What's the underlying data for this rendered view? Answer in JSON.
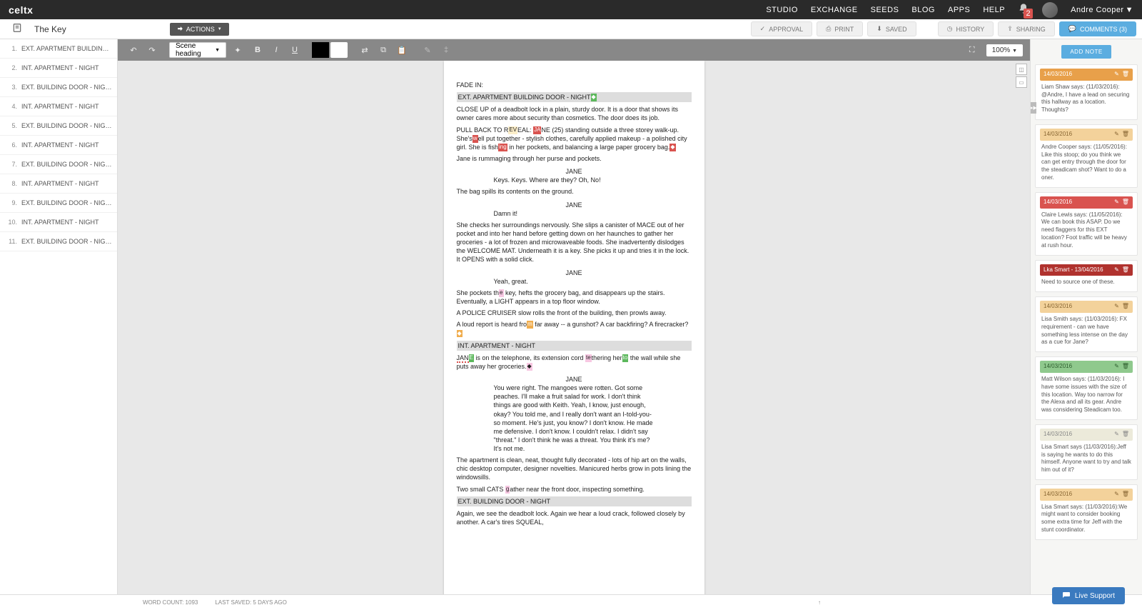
{
  "brand": "celtx",
  "nav": {
    "studio": "STUDIO",
    "exchange": "EXCHANGE",
    "seeds": "SEEDS",
    "blog": "BLOG",
    "apps": "APPS",
    "help": "HELP"
  },
  "user": "Andre Cooper",
  "notif_count": "2",
  "project_title": "The Key",
  "actions_label": "ACTIONS",
  "pills": {
    "approval": "APPROVAL",
    "print": "PRINT",
    "saved": "SAVED",
    "history": "HISTORY",
    "sharing": "SHARING",
    "comments": "COMMENTS (3)"
  },
  "format_dropdown": "Scene heading",
  "zoom": "100%",
  "scenes": [
    {
      "n": "1.",
      "t": "EXT. APARTMENT BUILDING DOOR ..."
    },
    {
      "n": "2.",
      "t": "INT. APARTMENT - NIGHT"
    },
    {
      "n": "3.",
      "t": "EXT. BUILDING DOOR - NIGHT"
    },
    {
      "n": "4.",
      "t": "INT. APARTMENT - NIGHT"
    },
    {
      "n": "5.",
      "t": "EXT. BUILDING DOOR - NIGHT"
    },
    {
      "n": "6.",
      "t": "INT. APARTMENT - NIGHT"
    },
    {
      "n": "7.",
      "t": "EXT. BUILDING DOOR - NIGHT"
    },
    {
      "n": "8.",
      "t": "INT. APARTMENT - NIGHT"
    },
    {
      "n": "9.",
      "t": "EXT. BUILDING DOOR - NIGHT"
    },
    {
      "n": "10.",
      "t": "INT. APARTMENT - NIGHT"
    },
    {
      "n": "11.",
      "t": "EXT. BUILDING DOOR - NIGHT"
    }
  ],
  "script": {
    "fade": "FADE IN:",
    "s1": "EXT. APARTMENT BUILDING DOOR - NIGHT",
    "a1": "CLOSE UP of a deadbolt lock in a plain, sturdy door. It is a door that shows its owner cares more about security than cosmetics. The door does its job.",
    "a2a": "PULL BACK TO R",
    "a2b": "EAL: ",
    "a2c": "NE (25) standing outside a three storey walk-up. She's",
    "a2d": "ell put together - stylish clothes, carefully applied makeup - a polished city girl. She is fish",
    "a2e": " in her pockets, and balancing a large paper grocery bag.",
    "a3": "Jane is rummaging through her purse and pockets.",
    "c1": "JANE",
    "d1": "Keys. Keys. Where are they? Oh, No!",
    "a4": "The bag spills its contents on the ground.",
    "c2": "JANE",
    "d2": "Damn it!",
    "a5": "She checks her surroundings nervously. She slips a canister of MACE out of her pocket and into her hand before getting down on her haunches to gather her groceries - a lot of frozen and microwaveable foods. She inadvertently dislodges the WELCOME MAT. Underneath it is a key. She picks it up and tries it in the lock. It OPENS with a solid click.",
    "c3": "JANE",
    "d3": "Yeah, great.",
    "a6": "She pockets th",
    "a6b": " key, hefts the grocery bag, and disappears up the stairs. Eventually, a LIGHT appears in a top floor window.",
    "a7": "A POLICE CRUISER slow rolls the front of the building, then prowls away.",
    "a8a": "A loud report is heard fro",
    "a8b": " far away -- a gunshot? A car backfiring? A firecracker?",
    "s2": "INT. APARTMENT - NIGHT",
    "a9a": "JAN",
    "a9b": " is on the telephone, its extension cord ",
    "a9c": "thering her",
    "a9d": " the wall while she puts away her groceries.",
    "c4": "JANE",
    "d4": "You were right. The mangoes were rotten. Got some peaches. I'll make a fruit salad for work. I don't think things are good with Keith. Yeah, I know, just enough, okay? You told me, and I really don't want an I-told-you-so moment. He's just, you know? I don't know. He made me defensive. I don't know. I couldn't relax. I didn't say \"threat.\" I don't think he was a threat. You think it's me? It's not me.",
    "a10": "The apartment is clean, neat, thought fully decorated - lots of hip art on the walls, chic desktop computer, designer novelties. Manicured herbs grow in pots lining the windowsills.",
    "a11a": "Two small CATS ",
    "a11b": "ather near the front door, inspecting something.",
    "s3": "EXT. BUILDING DOOR - NIGHT",
    "a12": "Again, we see the deadbolt lock. Again we hear a loud crack, followed closely by another.  A car's tires SQUEAL,"
  },
  "add_note": "ADD NOTE",
  "notes": [
    {
      "hdr": "orange",
      "date": "14/03/2016",
      "body": "Liam Shaw says: (11/03/2016): @Andre, I have a lead on securing this hallway as a location. Thoughts?"
    },
    {
      "hdr": "ltorange",
      "date": "14/03/2016",
      "body": "Andre Cooper says: (11/05/2016): Like this stoop; do you think we can get entry through the door for the steadicam shot? Want to do a oner."
    },
    {
      "hdr": "red",
      "date": "14/03/2016",
      "body": "Claire Lewis says: (11/05/2016): We can book this ASAP. Do we need flaggers for this EXT location? Foot traffic will be heavy at rush hour."
    },
    {
      "hdr": "darkred",
      "date": "Lka Smart - 13/04/2016",
      "body": "Need to source one of these."
    },
    {
      "hdr": "ltorange",
      "date": "14/03/2016",
      "body": "Lisa Smith says: (11/03/2016): FX requirement - can we have something less intense on the day as a cue for Jane?"
    },
    {
      "hdr": "green",
      "date": "14/03/2016",
      "body": "Matt Wilson says: (11/03/2016): I have some issues with the size of this location. Way too narrow for the Alexa and all its gear. Andre was considering Steadicam too."
    },
    {
      "hdr": "pale",
      "date": "14/03/2016",
      "body": "Lisa Smart says (11/03/2016):Jeff is saying he wants to do this himself. Anyone want to try and talk him out of it?"
    },
    {
      "hdr": "ltorange",
      "date": "14/03/2016",
      "body": "Lisa Smart says: (11/03/2016):We might want to consider booking some extra time for Jeff with the stunt coordinator."
    }
  ],
  "word_count": "WORD COUNT: 1093",
  "last_saved": "LAST SAVED: 5 DAYS AGO",
  "jump": "↑",
  "live_support": "Live Support"
}
